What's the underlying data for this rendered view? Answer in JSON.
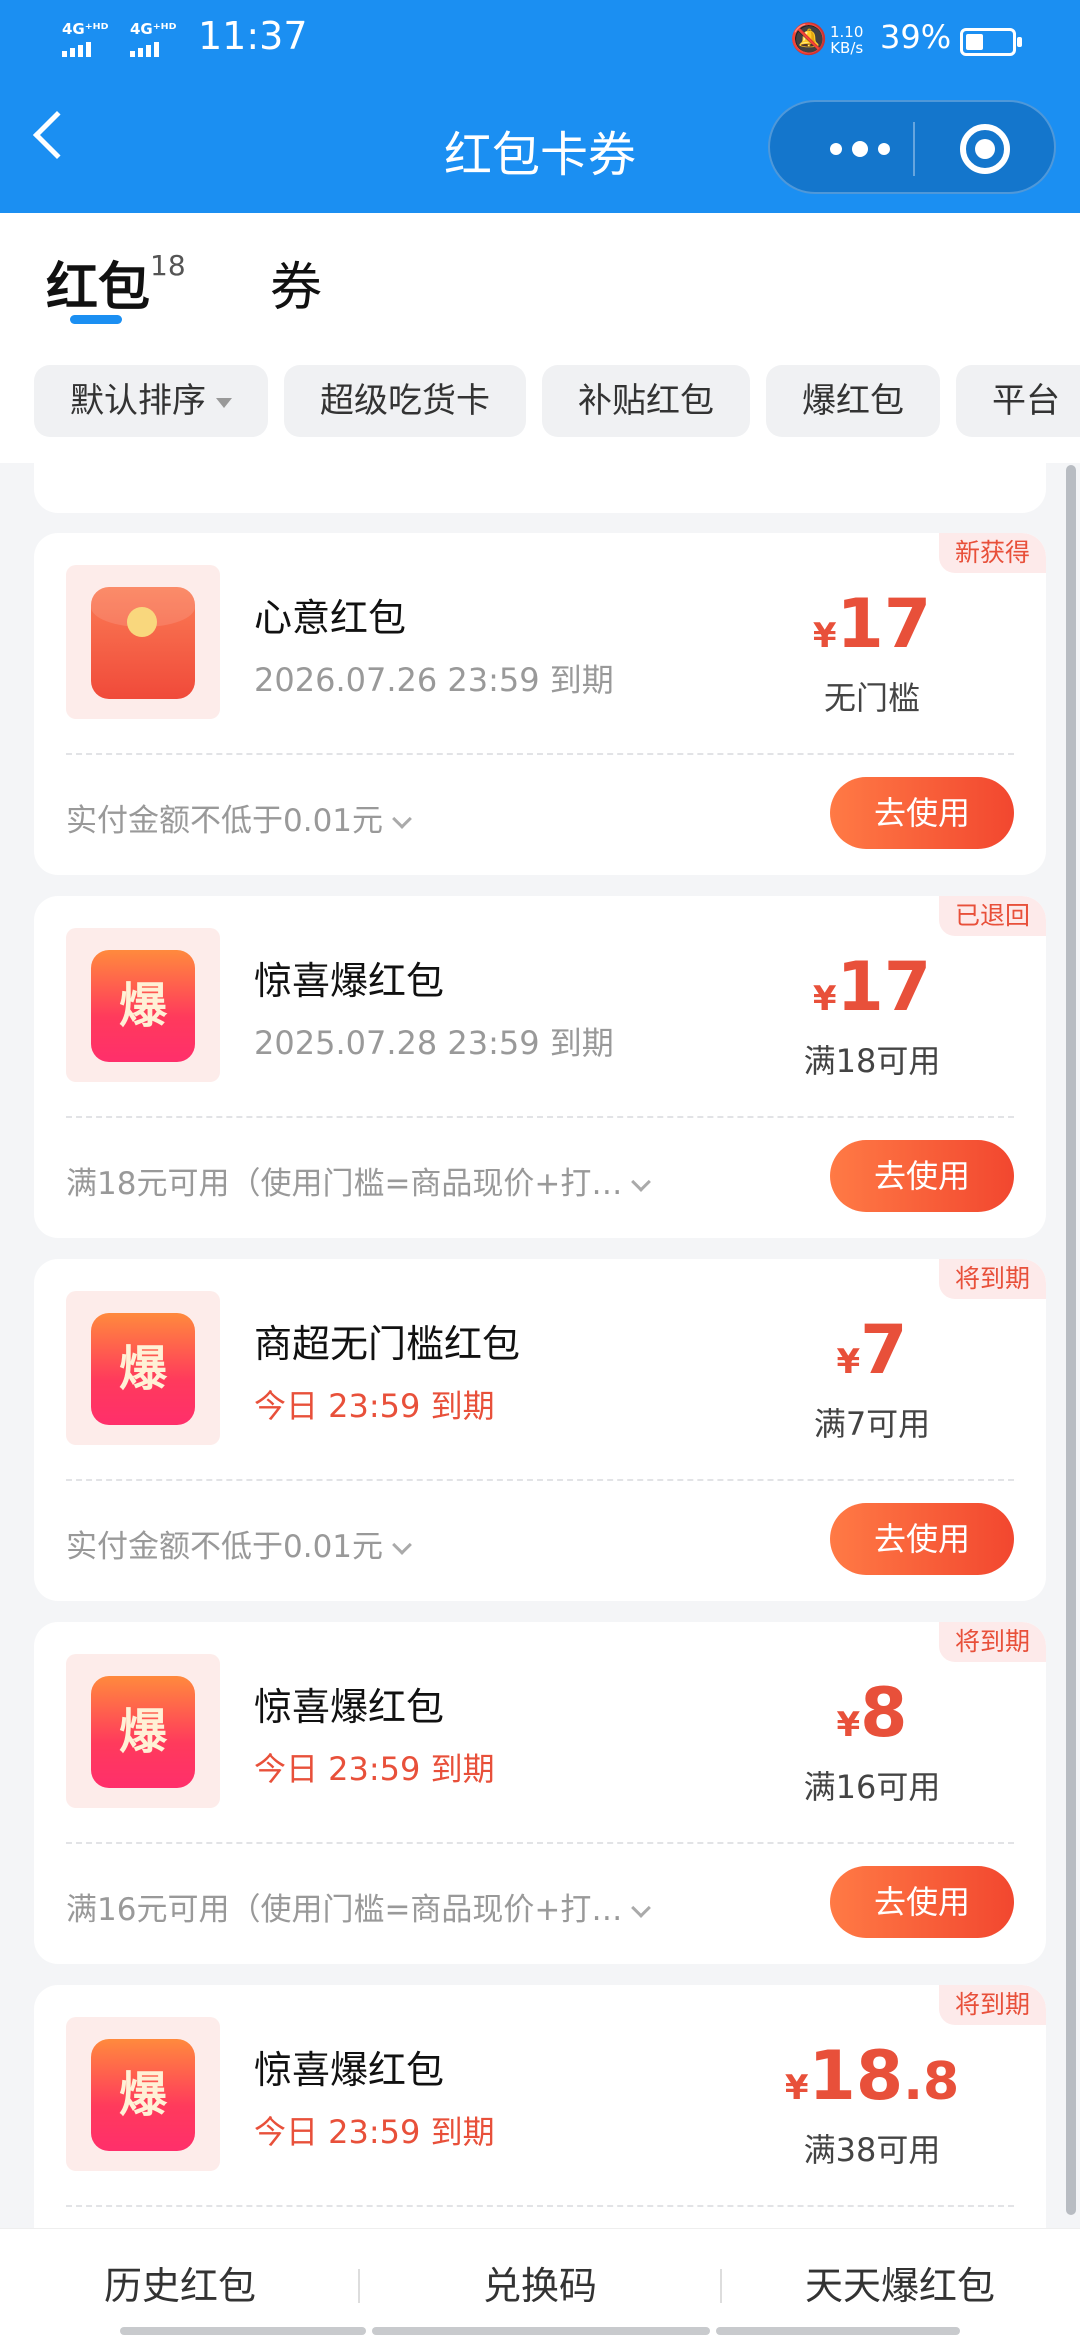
{
  "status_bar": {
    "sim1": "4G⁺ᴴᴰ",
    "sim2": "4G⁺ᴴᴰ",
    "time": "11:37",
    "speed_value": "1.10",
    "speed_unit": "KB/s",
    "battery": "39%",
    "battery_level": 0.39
  },
  "header": {
    "title": "红包卡券"
  },
  "tabs": {
    "redpacket_label": "红包",
    "redpacket_count": "18",
    "coupon_label": "券"
  },
  "filters": [
    "默认排序",
    "超级吃货卡",
    "补贴红包",
    "爆红包",
    "平台"
  ],
  "cards": [
    {
      "tag": "新获得",
      "name": "心意红包",
      "expiry": "2026.07.26 23:59 到期",
      "yen": "¥",
      "amount": "17",
      "decimal": "",
      "condition": "无门槛",
      "rule": "实付金额不低于0.01元",
      "button": "去使用",
      "icon": "envelope-icon"
    },
    {
      "tag": "已退回",
      "name": "惊喜爆红包",
      "expiry": "2025.07.28 23:59 到期",
      "yen": "¥",
      "amount": "17",
      "decimal": "",
      "condition": "满18可用",
      "rule": "满18元可用（使用门槛=商品现价+打…",
      "button": "去使用",
      "icon": "bao-icon",
      "icon_char": "爆"
    },
    {
      "tag": "将到期",
      "name": "商超无门槛红包",
      "expiry": "今日 23:59 到期",
      "yen": "¥",
      "amount": "7",
      "decimal": "",
      "condition": "满7可用",
      "rule": "实付金额不低于0.01元",
      "button": "去使用",
      "icon": "bao-icon",
      "icon_char": "爆"
    },
    {
      "tag": "将到期",
      "name": "惊喜爆红包",
      "expiry": "今日 23:59 到期",
      "yen": "¥",
      "amount": "8",
      "decimal": "",
      "condition": "满16可用",
      "rule": "满16元可用（使用门槛=商品现价+打…",
      "button": "去使用",
      "icon": "bao-icon",
      "icon_char": "爆"
    },
    {
      "tag": "将到期",
      "name": "惊喜爆红包",
      "expiry": "今日 23:59 到期",
      "yen": "¥",
      "amount": "18",
      "decimal": ".8",
      "condition": "满38可用",
      "icon": "bao-icon",
      "icon_char": "爆"
    }
  ],
  "bottom_nav": [
    "历史红包",
    "兑换码",
    "天天爆红包"
  ],
  "colors": {
    "header_blue": "#1b8ff2",
    "accent_red": "#e8503a",
    "button_gradient_start": "#ff7a45",
    "button_gradient_end": "#f2472f"
  }
}
